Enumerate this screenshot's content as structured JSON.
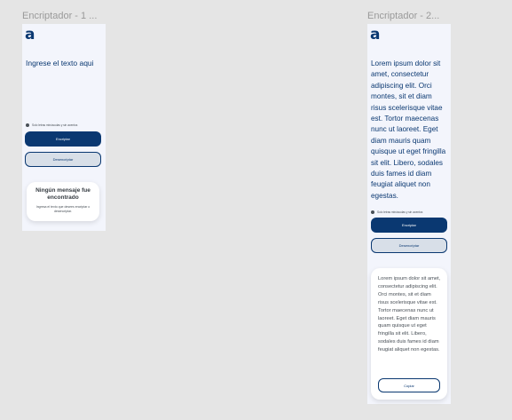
{
  "frames": [
    {
      "title": "Encriptador - 1 ...",
      "logo": "a",
      "input_placeholder": "Ingrese el texto aqui",
      "hint": "Solo letras minúsculas y sin acentos",
      "encrypt_label": "Encriptar",
      "decrypt_label": "Desencriptar",
      "card": {
        "title": "Ningún mensaje fue encontrado",
        "subtitle": "Ingresa el texto que desees encriptar o desencriptar."
      }
    },
    {
      "title": "Encriptador - 2...",
      "logo": "a",
      "input_value": "Lorem ipsum dolor sit amet, consectetur adipiscing elit. Orci montes, sit et diam risus scelerisque vitae est. Tortor maecenas nunc ut laoreet. Eget diam mauris quam quisque ut eget fringilla sit elit. Libero, sodales duis fames id diam feugiat aliquet non egestas.",
      "hint": "Solo letras minúsculas y sin acentos",
      "encrypt_label": "Encriptar",
      "decrypt_label": "Desencriptar",
      "card": {
        "result": "Lorem ipsum dolor sit amet, consectetur adipiscing elit. Orci montes, sit et diam risus scelerisque vitae est. Tortor maecenas nunc ut laoreet. Eget diam mauris quam quisque ut eget fringilla sit elit. Libero, sodales duis fames id diam feugiat aliquet non egestas.",
        "copy_label": "Copiar"
      }
    }
  ],
  "colors": {
    "canvas": "#e5e5e5",
    "frame_bg": "#f3f5fc",
    "primary": "#0a3871",
    "card_bg": "#ffffff"
  }
}
